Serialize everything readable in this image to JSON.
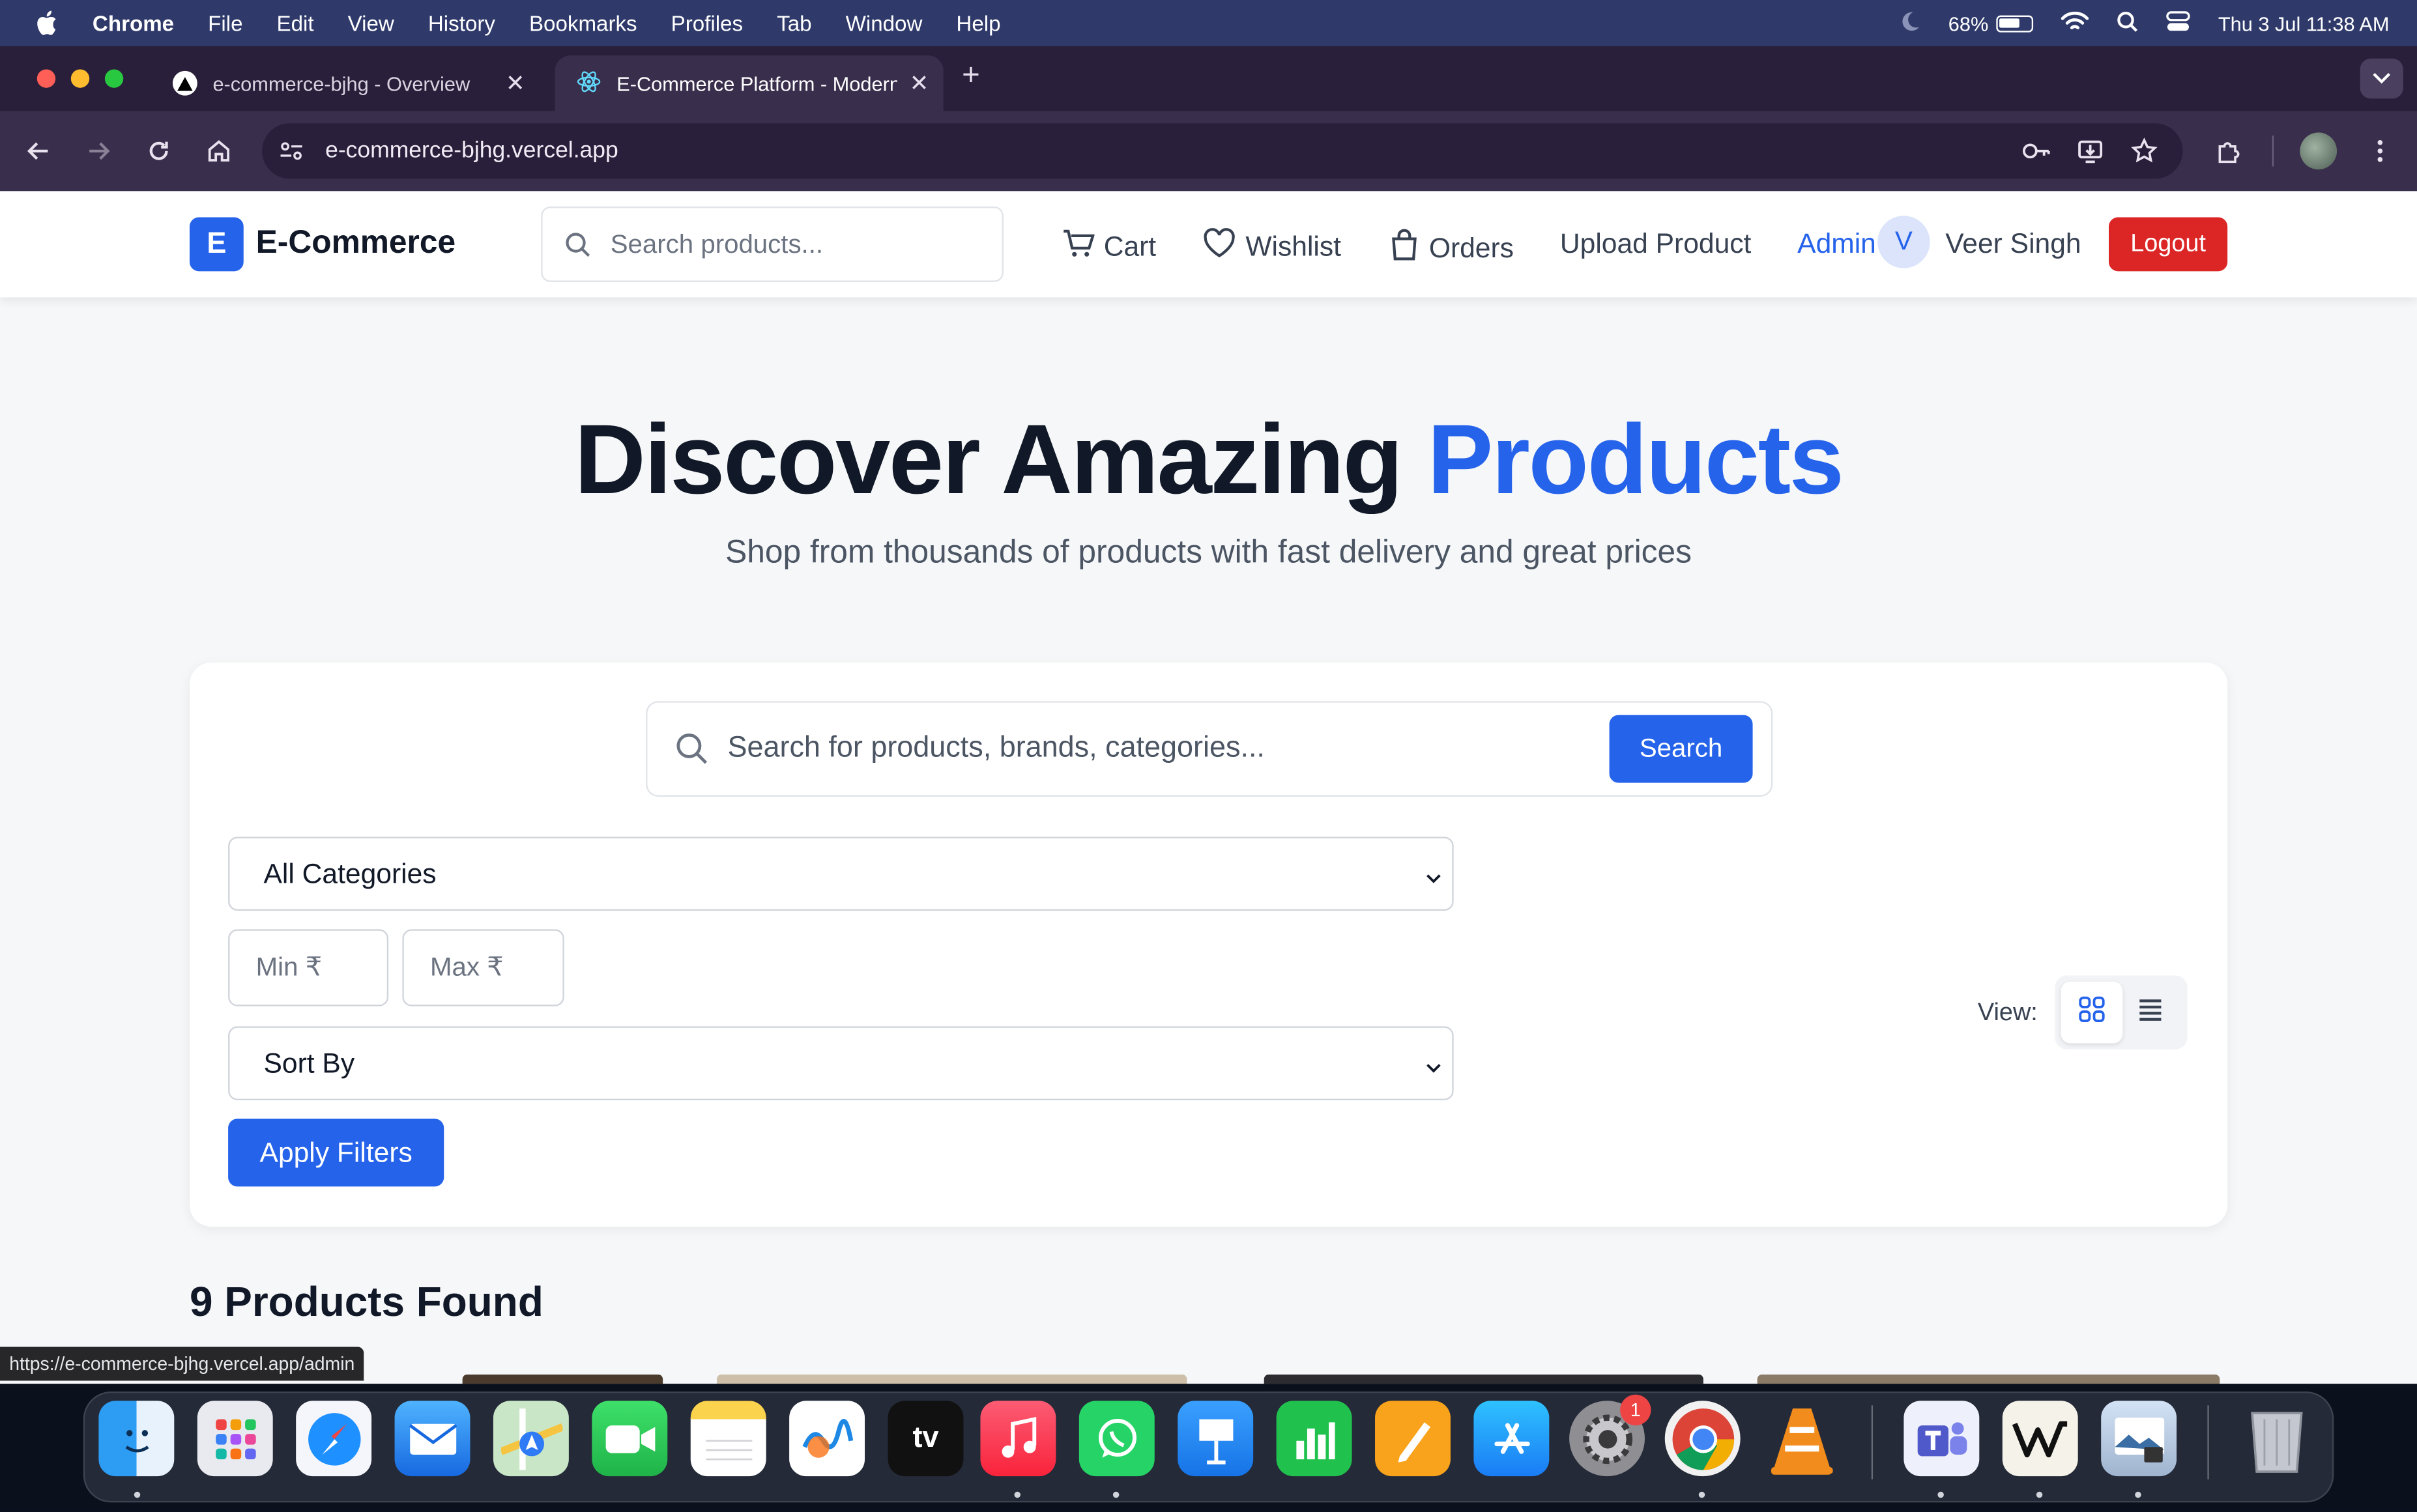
{
  "menubar": {
    "app": "Chrome",
    "items": [
      "File",
      "Edit",
      "View",
      "History",
      "Bookmarks",
      "Profiles",
      "Tab",
      "Window",
      "Help"
    ],
    "battery_percent": "68%",
    "battery_level": 0.68,
    "datetime": "Thu 3 Jul  11:38 AM"
  },
  "tabs": [
    {
      "title": "e-commerce-bjhg - Overview",
      "active": false
    },
    {
      "title": "E-Commerce Platform - Modern",
      "active": true
    }
  ],
  "toolbar": {
    "url": "e-commerce-bjhg.vercel.app"
  },
  "navbar": {
    "logo_letter": "E",
    "brand": "E-Commerce",
    "search_placeholder": "Search products...",
    "cart": "Cart",
    "wishlist": "Wishlist",
    "orders": "Orders",
    "upload": "Upload Product",
    "admin": "Admin",
    "avatar_initial": "V",
    "user_name": "Veer Singh",
    "logout": "Logout"
  },
  "hero": {
    "title_main": "Discover Amazing ",
    "title_accent": "Products",
    "subtitle": "Shop from thousands of products with fast delivery and great prices"
  },
  "filters": {
    "search_placeholder": "Search for products, brands, categories...",
    "search_button": "Search",
    "category_value": "All Categories",
    "min_placeholder": "Min ₹",
    "max_placeholder": "Max ₹",
    "sort_value": "Sort By",
    "apply_button": "Apply Filters",
    "view_label": "View:"
  },
  "results": {
    "count_text": "9 Products Found"
  },
  "status_url": "https://e-commerce-bjhg.vercel.app/admin",
  "colors": {
    "accent": "#2563eb",
    "logout": "#dc2626",
    "heading": "#111827"
  },
  "dock": {
    "apps": [
      "finder-icon",
      "launchpad-icon",
      "safari-icon",
      "mail-icon",
      "maps-icon",
      "facetime-icon",
      "notes-icon",
      "freeform-icon",
      "apple-tv-icon",
      "music-icon",
      "whatsapp-icon",
      "keynote-icon",
      "numbers-icon",
      "pages-icon",
      "app-store-icon",
      "system-settings-icon",
      "chrome-icon",
      "vlc-icon",
      "teams-icon",
      "notion-icon",
      "preview-icon",
      "trash-icon"
    ],
    "tv_label": "tv",
    "settings_badge": "1"
  }
}
